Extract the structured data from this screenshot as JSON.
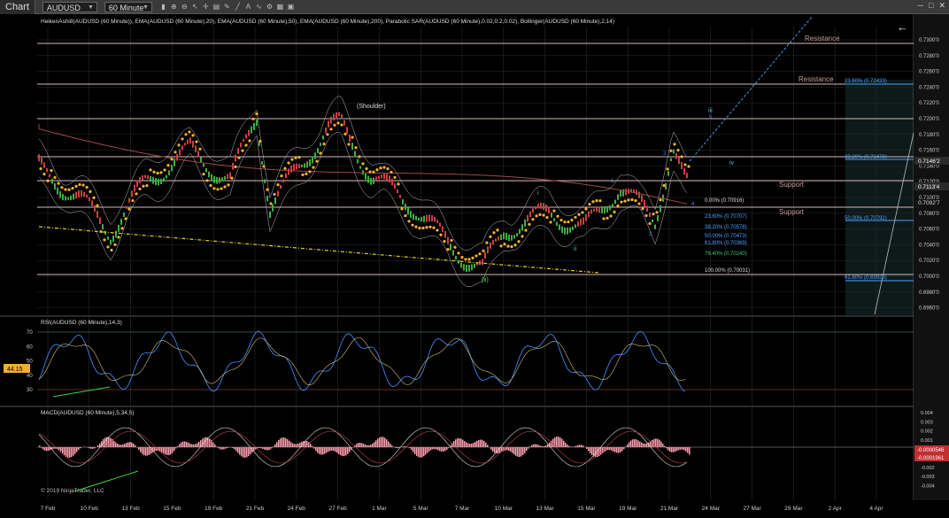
{
  "toolbar": {
    "title": "Chart",
    "instrument": "AUDUSD",
    "interval": "60 Minute"
  },
  "indicators_header": "HeikenAshi8(AUDUSD (60 Minute)), EMA(AUDUSD (60 Minute),20), EMA(AUDUSD (60 Minute),50), EMA(AUDUSD (60 Minute),200), Parabolic SAR(AUDUSD (60 Minute),0.02,0.2,0.02), Bollinger(AUDUSD (60 Minute),2,14)",
  "rsi_header": "RSI(AUDUSD (60 Minute),14,3)",
  "macd_header": "MACD(AUDUSD (60 Minute),5,34,5)",
  "copyright": "© 2019 NinjaTrader, LLC",
  "colors": {
    "background": "#000000",
    "grid": "#2a2a2a",
    "level_line": "#d8b8b8",
    "sar": "#f0b030",
    "ema": "#a04848",
    "trendline": "#e8d020",
    "projection": "#5090e0",
    "wave_label": "#40c0d0",
    "fib_blue": "#4aa0ff",
    "fib_green": "#40c080",
    "rsi_line": "#4a90ff",
    "macd_hist": "#ff9fb0"
  },
  "price_axis": [
    "0.7300'0",
    "0.7280'0",
    "0.7260'0",
    "0.7240'0",
    "0.7220'0",
    "0.7200'0",
    "0.7180'0",
    "0.7160'0",
    "0.7140'0",
    "0.7120'0",
    "0.7100'0",
    "0.7080'0",
    "0.7060'0",
    "0.7040'0",
    "0.7020'0",
    "0.7000'0",
    "0.6980'0",
    "0.6960'0"
  ],
  "price_badges": {
    "current": "0.7146'2",
    "second": "0.7113'4",
    "third": "0.7092'7"
  },
  "level_labels": {
    "resistance1": "Resistance",
    "resistance2": "Resistance",
    "support1": "Support",
    "support2": "Support",
    "shoulder": "(Shoulder)"
  },
  "wave_labels": [
    "iii",
    "iv",
    "i",
    "ii",
    "(ii)",
    "3",
    "4",
    "1",
    "2",
    "5"
  ],
  "fib_levels": [
    {
      "text": "0.00% (0.70916)",
      "color": "#dddddd"
    },
    {
      "text": "23.60% (0.70707)",
      "color": "#4aa0ff"
    },
    {
      "text": "38.20% (0.70578)",
      "color": "#4aa0ff"
    },
    {
      "text": "50.00% (0.70473)",
      "color": "#4aa0ff"
    },
    {
      "text": "61.80% (0.70369)",
      "color": "#4aa0ff"
    },
    {
      "text": "76.40% (0.70240)",
      "color": "#40c080"
    },
    {
      "text": "100.00% (0.70031)",
      "color": "#dddddd"
    }
  ],
  "fib_ext": [
    {
      "text": "23.60% (0.72433)"
    },
    {
      "text": "38.20% (0.71476)"
    },
    {
      "text": "50.00% (0.70792)"
    },
    {
      "text": "61.80% (0.69925)"
    }
  ],
  "rsi_axis": [
    "70",
    "60",
    "50",
    "40",
    "30"
  ],
  "rsi_badge": "44.15",
  "macd_axis": [
    "0.004",
    "0.003",
    "0.002",
    "0.001",
    "0",
    "-0.001",
    "-0.002",
    "-0.003",
    "-0.004"
  ],
  "macd_badges": [
    "-0.0000546",
    "-0.0001961"
  ],
  "date_axis": [
    "7 Feb",
    "10 Feb",
    "13 Feb",
    "15 Feb",
    "19 Feb",
    "21 Feb",
    "24 Feb",
    "27 Feb",
    "1 Mar",
    "5 Mar",
    "7 Mar",
    "10 Mar",
    "13 Mar",
    "15 Mar",
    "19 Mar",
    "21 Mar",
    "24 Mar",
    "27 Mar",
    "29 Mar",
    "2 Apr",
    "4 Apr"
  ]
}
